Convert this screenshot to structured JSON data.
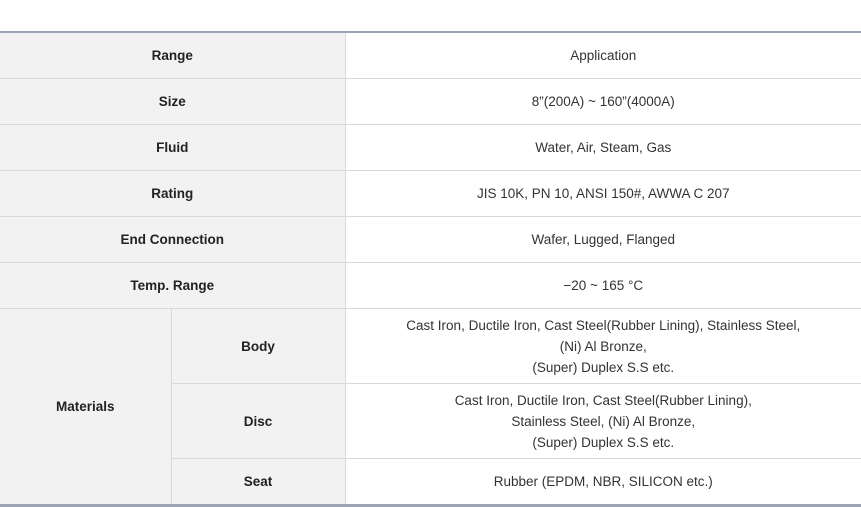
{
  "table": {
    "header": {
      "label": "Range",
      "value": "Application"
    },
    "rows": [
      {
        "label": "Size",
        "value": "8”(200A) ~ 160”(4000A)"
      },
      {
        "label": "Fluid",
        "value": "Water, Air, Steam, Gas"
      },
      {
        "label": "Rating",
        "value": "JIS 10K, PN 10, ANSI 150#, AWWA C 207"
      },
      {
        "label": "End Connection",
        "value": "Wafer, Lugged, Flanged"
      },
      {
        "label": "Temp. Range",
        "value": "−20 ~ 165 °C"
      }
    ],
    "materials": {
      "label": "Materials",
      "body": {
        "label": "Body",
        "lines": [
          "Cast Iron, Ductile Iron, Cast Steel(Rubber Lining), Stainless Steel,",
          "(Ni) Al Bronze,",
          "(Super) Duplex S.S etc."
        ]
      },
      "disc": {
        "label": "Disc",
        "lines": [
          "Cast Iron, Ductile Iron, Cast Steel(Rubber Lining),",
          "Stainless Steel, (Ni) Al Bronze,",
          "(Super) Duplex S.S etc."
        ]
      },
      "seat": {
        "label": "Seat",
        "value": "Rubber (EPDM, NBR, SILICON etc.)"
      }
    }
  }
}
